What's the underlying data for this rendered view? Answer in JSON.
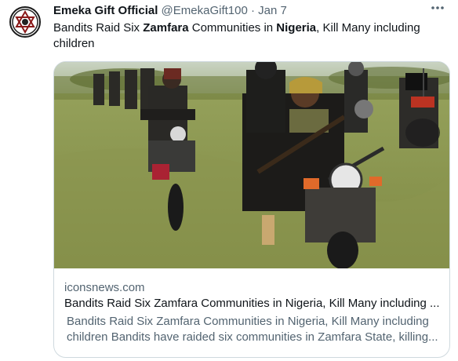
{
  "tweet": {
    "author_name": "Emeka Gift Official",
    "handle": "@EmekaGift100",
    "separator": "·",
    "date": "Jan 7",
    "more_icon": "more-horizontal-icon",
    "text_parts": [
      {
        "text": "Bandits Raid Six ",
        "bold": false
      },
      {
        "text": "Zamfara",
        "bold": true
      },
      {
        "text": " Communities in ",
        "bold": false
      },
      {
        "text": "Nigeria",
        "bold": true
      },
      {
        "text": ", Kill Many including children",
        "bold": false
      }
    ]
  },
  "card": {
    "domain": "iconsnews.com",
    "title": "Bandits Raid Six Zamfara Communities in Nigeria, Kill Many including ...",
    "description_line1": "Bandits Raid Six Zamfara Communities in Nigeria, Kill Many including",
    "description_line2": "children Bandits have raided six communities in Zamfara State, killing..."
  },
  "colors": {
    "text_primary": "#0f1419",
    "text_secondary": "#536471",
    "border": "#cfd9de"
  }
}
